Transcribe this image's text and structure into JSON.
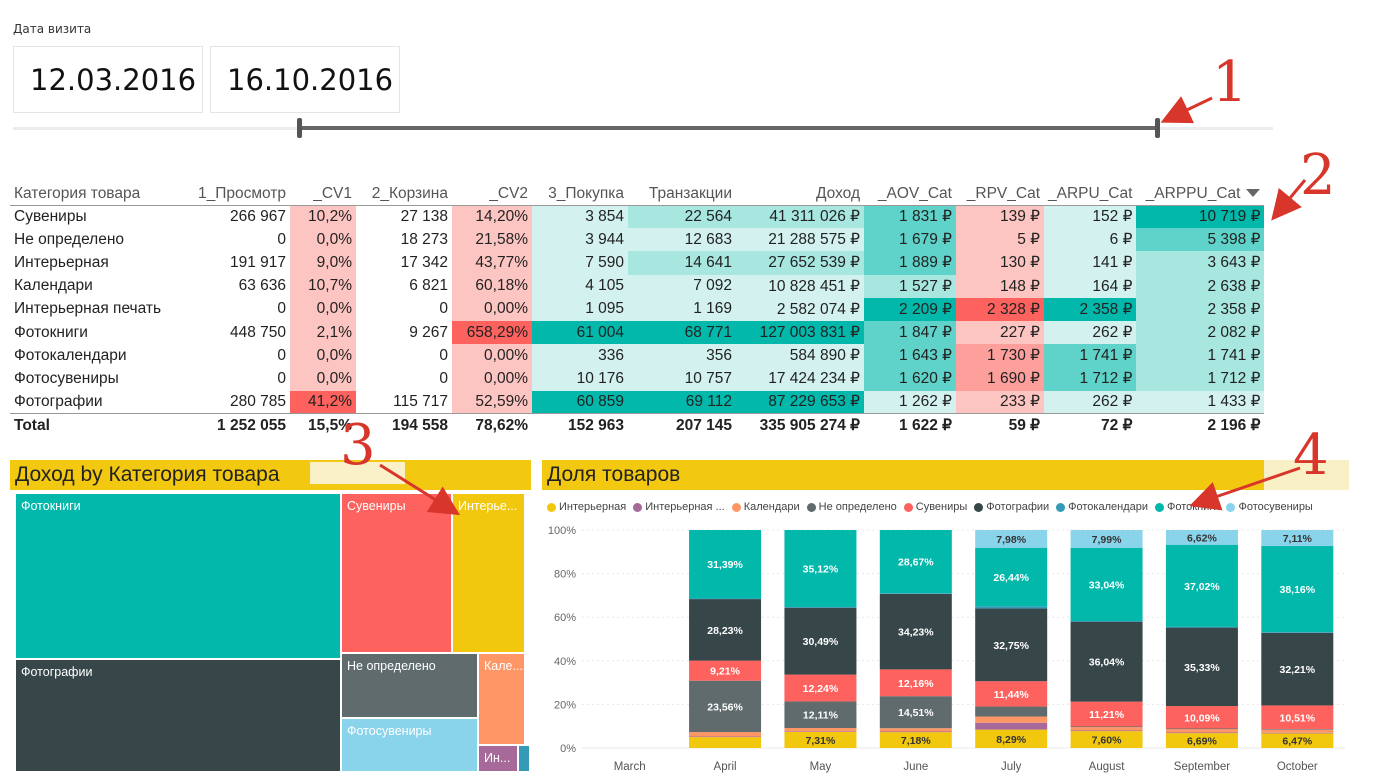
{
  "slicer": {
    "label": "Дата визита",
    "start_date": "12.03.2016",
    "end_date": "16.10.2016"
  },
  "annotations": [
    "1",
    "2",
    "3",
    "4"
  ],
  "matrix": {
    "headers": [
      "Категория товара",
      "1_Просмотр",
      "_CV1",
      "2_Корзина",
      "_CV2",
      "3_Покупка",
      "Транзакции",
      "Доход",
      "_AOV_Cat",
      "_RPV_Cat",
      "_ARPU_Cat",
      "_ARPPU_Cat"
    ],
    "rows": [
      [
        "Сувениры",
        "266 967",
        "10,2%",
        "27 138",
        "14,20%",
        "3 854",
        "22 564",
        "41 311 026 ₽",
        "1 831 ₽",
        "139 ₽",
        "152 ₽",
        "10 719 ₽"
      ],
      [
        "Не определено",
        "0",
        "0,0%",
        "18 273",
        "21,58%",
        "3 944",
        "12 683",
        "21 288 575 ₽",
        "1 679 ₽",
        "5 ₽",
        "6 ₽",
        "5 398 ₽"
      ],
      [
        "Интерьерная",
        "191 917",
        "9,0%",
        "17 342",
        "43,77%",
        "7 590",
        "14 641",
        "27 652 539 ₽",
        "1 889 ₽",
        "130 ₽",
        "141 ₽",
        "3 643 ₽"
      ],
      [
        "Календари",
        "63 636",
        "10,7%",
        "6 821",
        "60,18%",
        "4 105",
        "7 092",
        "10 828 451 ₽",
        "1 527 ₽",
        "148 ₽",
        "164 ₽",
        "2 638 ₽"
      ],
      [
        "Интерьерная печать",
        "0",
        "0,0%",
        "0",
        "0,00%",
        "1 095",
        "1 169",
        "2 582 074 ₽",
        "2 209 ₽",
        "2 328 ₽",
        "2 358 ₽",
        "2 358 ₽"
      ],
      [
        "Фотокниги",
        "448 750",
        "2,1%",
        "9 267",
        "658,29%",
        "61 004",
        "68 771",
        "127 003 831 ₽",
        "1 847 ₽",
        "227 ₽",
        "262 ₽",
        "2 082 ₽"
      ],
      [
        "Фотокалендари",
        "0",
        "0,0%",
        "0",
        "0,00%",
        "336",
        "356",
        "584 890 ₽",
        "1 643 ₽",
        "1 730 ₽",
        "1 741 ₽",
        "1 741 ₽"
      ],
      [
        "Фотосувениры",
        "0",
        "0,0%",
        "0",
        "0,00%",
        "10 176",
        "10 757",
        "17 424 234 ₽",
        "1 620 ₽",
        "1 690 ₽",
        "1 712 ₽",
        "1 712 ₽"
      ],
      [
        "Фотографии",
        "280 785",
        "41,2%",
        "115 717",
        "52,59%",
        "60 859",
        "69 112",
        "87 229 653 ₽",
        "1 262 ₽",
        "233 ₽",
        "262 ₽",
        "1 433 ₽"
      ]
    ],
    "total": [
      "Total",
      "1 252 055",
      "15,5%",
      "194 558",
      "78,62%",
      "152 963",
      "207 145",
      "335 905 274 ₽",
      "1 622 ₽",
      "59 ₽",
      "72 ₽",
      "2 196 ₽"
    ],
    "cell_colors": {
      "teal_strong": "#01b8aa",
      "teal_mid": "#5fd3c9",
      "teal_light": "#a8e6e0",
      "teal_pale": "#d3f2ef",
      "red_strong": "#fd625e",
      "red_mid": "#fda09c",
      "red_light": "#fdc5c2",
      "red_pale": "#fde2e0"
    }
  },
  "treemap": {
    "title": "Доход by Категория товара",
    "tiles": [
      {
        "label": "Фотокниги",
        "color": "#01b8aa"
      },
      {
        "label": "Фотографии",
        "color": "#374649"
      },
      {
        "label": "Сувениры",
        "color": "#fd625e"
      },
      {
        "label": "Интерье...",
        "color": "#f2c80f"
      },
      {
        "label": "Не определено",
        "color": "#5f6b6d"
      },
      {
        "label": "Фотосувениры",
        "color": "#8ad4eb"
      },
      {
        "label": "Кале...",
        "color": "#fe9666"
      },
      {
        "label": "Ин...",
        "color": "#a66999"
      },
      {
        "label": "",
        "color": "#3599b8"
      }
    ]
  },
  "chart_data": {
    "type": "bar",
    "title": "Доля товаров",
    "stacked": "100%",
    "categories": [
      "March",
      "April",
      "May",
      "June",
      "July",
      "August",
      "September",
      "October"
    ],
    "y_ticks": [
      "0%",
      "20%",
      "40%",
      "60%",
      "80%",
      "100%"
    ],
    "ylim": [
      0,
      100
    ],
    "legend_position": "top-left",
    "series": [
      {
        "name": "Интерьерная",
        "color": "#f2c80f",
        "values": [
          0,
          5.0,
          7.31,
          7.18,
          8.29,
          7.6,
          6.69,
          6.47
        ],
        "labels": [
          "",
          "",
          "7,31%",
          "7,18%",
          "8,29%",
          "7,60%",
          "6,69%",
          "6,47%"
        ]
      },
      {
        "name": "Интерьерная ...",
        "color": "#a66999",
        "values": [
          0,
          0.3,
          0.3,
          0.3,
          3.1,
          0.3,
          0.3,
          0.3
        ],
        "labels": [
          "",
          "",
          "",
          "",
          "",
          "",
          "",
          ""
        ]
      },
      {
        "name": "Календари",
        "color": "#fe9666",
        "values": [
          0,
          2.0,
          1.5,
          1.5,
          2.8,
          1.5,
          1.5,
          1.3
        ],
        "labels": [
          "",
          "",
          "",
          "",
          "",
          "",
          "",
          ""
        ]
      },
      {
        "name": "Не определено",
        "color": "#5f6b6d",
        "values": [
          0,
          23.56,
          12.11,
          14.51,
          4.5,
          0.3,
          0.3,
          0.3
        ],
        "labels": [
          "",
          "23,56%",
          "12,11%",
          "14,51%",
          "",
          "",
          "",
          ""
        ]
      },
      {
        "name": "Сувениры",
        "color": "#fd625e",
        "values": [
          0,
          9.21,
          12.24,
          12.16,
          11.44,
          11.21,
          10.09,
          10.51
        ],
        "labels": [
          "",
          "9,21%",
          "12,24%",
          "12,16%",
          "11,44%",
          "11,21%",
          "10,09%",
          "10,51%"
        ]
      },
      {
        "name": "Фотографии",
        "color": "#374649",
        "values": [
          0,
          28.23,
          30.49,
          34.23,
          32.75,
          36.04,
          35.33,
          32.21
        ],
        "labels": [
          "",
          "28,23%",
          "30,49%",
          "34,23%",
          "32,75%",
          "36,04%",
          "35,33%",
          "32,21%"
        ]
      },
      {
        "name": "Фотокалендари",
        "color": "#3599b8",
        "values": [
          0,
          0.3,
          0.3,
          0.3,
          1.0,
          0.3,
          0.3,
          0.3
        ],
        "labels": [
          "",
          "",
          "",
          "",
          "",
          "",
          "",
          ""
        ]
      },
      {
        "name": "Фотокниги",
        "color": "#01b8aa",
        "values": [
          0,
          31.39,
          35.12,
          28.67,
          26.44,
          33.04,
          37.02,
          38.16
        ],
        "labels": [
          "",
          "31,39%",
          "35,12%",
          "28,67%",
          "26,44%",
          "33,04%",
          "37,02%",
          "38,16%"
        ]
      },
      {
        "name": "Фотосувениры",
        "color": "#8ad4eb",
        "values": [
          0,
          0,
          0,
          0,
          7.98,
          7.99,
          6.62,
          7.11
        ],
        "labels": [
          "",
          "",
          "",
          "",
          "7,98%",
          "7,99%",
          "6,62%",
          "7,11%"
        ]
      }
    ]
  }
}
